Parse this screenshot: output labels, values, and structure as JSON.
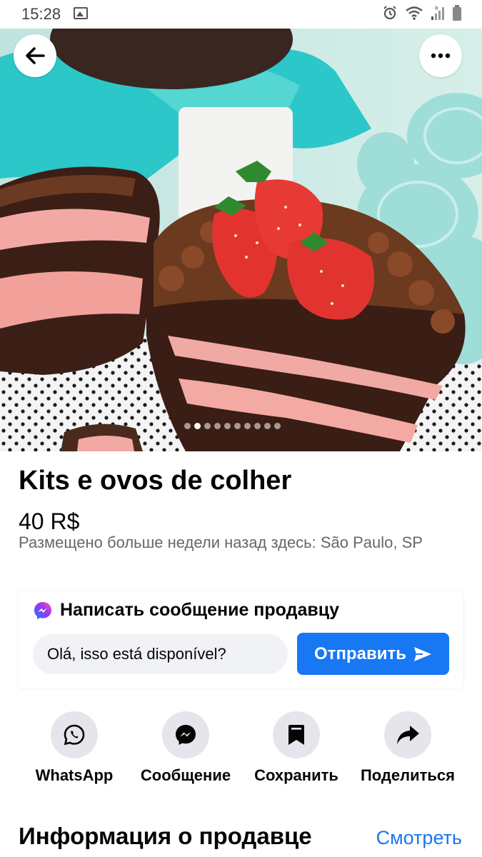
{
  "status_bar": {
    "time": "15:28",
    "icons": [
      "image-icon",
      "alarm-icon",
      "wifi-icon",
      "signal-icon",
      "battery-icon"
    ]
  },
  "hero": {
    "photo_count": 10,
    "active_index": 1
  },
  "listing": {
    "title": "Kits e ovos de colher",
    "price": "40 R$",
    "meta": "Размещено больше недели назад здесь: São Paulo, SP"
  },
  "message": {
    "heading": "Написать сообщение продавцу",
    "input_value": "Olá, isso está disponível?",
    "send_label": "Отправить"
  },
  "actions": [
    {
      "label": "WhatsApp",
      "icon": "whatsapp-icon"
    },
    {
      "label": "Сообщение",
      "icon": "messenger-icon"
    },
    {
      "label": "Сохранить",
      "icon": "bookmark-icon"
    },
    {
      "label": "Поделиться",
      "icon": "share-icon"
    }
  ],
  "seller": {
    "heading": "Информация о продавце",
    "link": "Смотреть"
  },
  "colors": {
    "accent": "#1877f2",
    "text": "#050505",
    "muted": "#65676b",
    "chip": "#e4e6eb"
  }
}
